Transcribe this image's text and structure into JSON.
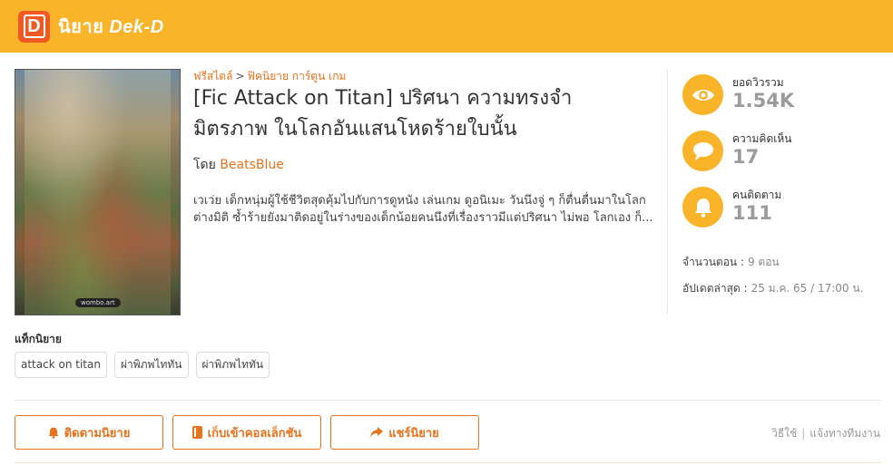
{
  "header": {
    "logo_letter": "D",
    "site_name": "นิยาย",
    "brand": "Dek-D",
    "bar_color": "#f9b429",
    "logo_color": "#ee5a22"
  },
  "cover": {
    "watermark": "wombo.art"
  },
  "breadcrumb": {
    "category": "ฟรีสไตล์",
    "separator": ">",
    "subcategory": "ฟิคนิยาย การ์ตูน เกม"
  },
  "story": {
    "title": "[Fic Attack on Titan] ปริศนา ความทรงจำ มิตรภาพ ในโลกอันแสนโหดร้ายใบนั้น",
    "author_prefix": "โดย",
    "author_name": "BeatsBlue",
    "synopsis": "เวเว่ย เด็กหนุ่มผู้ใช้ชีวิตสุดคุ้มไปกับการดูหนัง เล่นเกม ดูอนิเมะ วันนึงจู่ ๆ ก็ตื่นตื่นมาในโลกต่างมิติ ซ้ำร้ายยังมาติดอยู่ในร่างของเด็กน้อยคนนึงที่เรื่องราวมีแต่ปริศนา ไม่พอ โลกเอง ก็..."
  },
  "stats": [
    {
      "label": "ยอดวิวรวม",
      "value": "1.54K",
      "icon": "eye-icon"
    },
    {
      "label": "ความคิดเห็น",
      "value": "17",
      "icon": "comment-icon"
    },
    {
      "label": "คนติดตาม",
      "value": "111",
      "icon": "bell-icon"
    }
  ],
  "meta": {
    "chapters_label": "จำนวนตอน :",
    "chapters_value": "9 ตอน",
    "updated_label": "อัปเดตล่าสุด :",
    "updated_value": "25 ม.ค. 65 / 17:00 น."
  },
  "tags": {
    "title": "แท็กนิยาย",
    "items": [
      "attack on titan",
      "ผ่าพิภพไททัน",
      "ผ่าพิภพไททัน"
    ]
  },
  "actions": {
    "follow_label": "ติดตามนิยาย",
    "collect_label": "เก็บเข้าคอลเล็กชัน",
    "share_label": "แชร์นิยาย",
    "accent_color": "#e8721c"
  },
  "footer": {
    "howto_label": "วิธีใช้",
    "separator": "|",
    "report_label": "แจ้งทางทีมงาน"
  }
}
